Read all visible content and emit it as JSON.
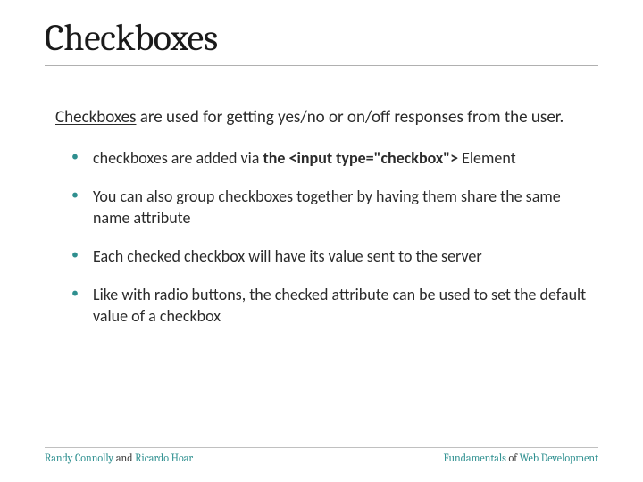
{
  "title": "Checkboxes",
  "subtitle": {
    "lead": "Checkboxes",
    "rest": " are used for getting yes/no or on/off responses from the user."
  },
  "bullets": [
    {
      "pre": "checkboxes are added via ",
      "bold": "the <input type=\"checkbox\">",
      "post": " Element"
    },
    {
      "pre": "You can also group checkboxes together by having them share the same name attribute",
      "bold": "",
      "post": ""
    },
    {
      "pre": "Each checked checkbox will have its value sent to the server",
      "bold": "",
      "post": ""
    },
    {
      "pre": "Like with radio buttons, the checked attribute can be used to set the default value of a checkbox",
      "bold": "",
      "post": ""
    }
  ],
  "footer": {
    "left": {
      "a": "Randy Connolly",
      "mid": " and ",
      "b": "Ricardo Hoar"
    },
    "right": {
      "a": "Fundamentals",
      "mid": " of ",
      "b": "Web Development"
    }
  }
}
